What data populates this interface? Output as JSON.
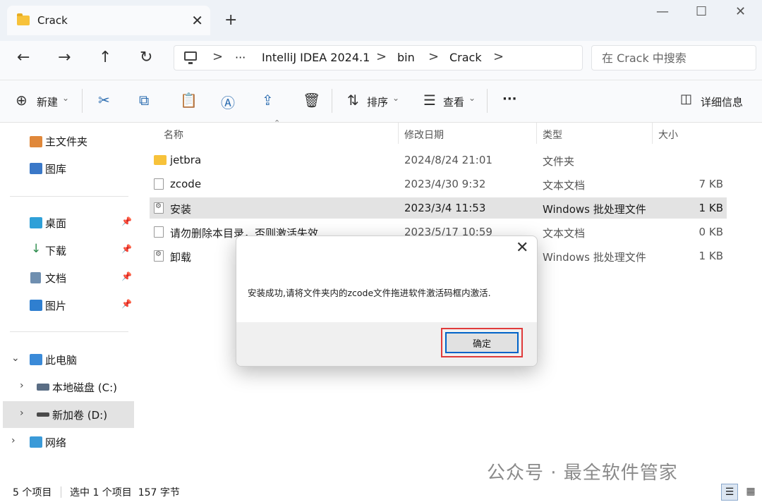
{
  "window": {
    "tab_title": "Crack",
    "close_tab": "✕",
    "new_tab": "+",
    "minimize": "—",
    "maximize": "☐",
    "close": "✕"
  },
  "nav": {
    "back": "←",
    "forward": "→",
    "up": "↑",
    "refresh": "↻"
  },
  "breadcrumb": {
    "more": "···",
    "items": [
      "IntelliJ IDEA 2024.1",
      "bin",
      "Crack"
    ],
    "separator": ">"
  },
  "search": {
    "placeholder": "在 Crack 中搜索"
  },
  "toolbar": {
    "new_label": "新建",
    "sort_label": "排序",
    "view_label": "查看",
    "more": "···",
    "details_label": "详细信息",
    "dropdown_caret": "⌄"
  },
  "sidebar": {
    "home": "主文件夹",
    "gallery": "图库",
    "quick": [
      {
        "label": "桌面",
        "icon": "desktop-icon"
      },
      {
        "label": "下载",
        "icon": "download-icon"
      },
      {
        "label": "文档",
        "icon": "document-icon"
      },
      {
        "label": "图片",
        "icon": "pictures-icon"
      }
    ],
    "pin": "📌",
    "this_pc": "此电脑",
    "drive_c": "本地磁盘 (C:)",
    "drive_d": "新加卷 (D:)",
    "network": "网络"
  },
  "columns": {
    "name": "名称",
    "modified": "修改日期",
    "type": "类型",
    "size": "大小"
  },
  "files": [
    {
      "name": "jetbra",
      "modified": "2024/8/24 21:01",
      "type": "文件夹",
      "size": "",
      "icon": "folder-icon"
    },
    {
      "name": "zcode",
      "modified": "2023/4/30 9:32",
      "type": "文本文档",
      "size": "7 KB",
      "icon": "text-file-icon"
    },
    {
      "name": "安装",
      "modified": "2023/3/4 11:53",
      "type": "Windows 批处理文件",
      "size": "1 KB",
      "icon": "batch-file-icon",
      "selected": true
    },
    {
      "name": "请勿删除本目录，否则激活失效",
      "modified": "2023/5/17 10:59",
      "type": "文本文档",
      "size": "0 KB",
      "icon": "text-file-icon"
    },
    {
      "name": "卸载",
      "modified": "",
      "type": "Windows 批处理文件",
      "size": "1 KB",
      "icon": "batch-file-icon"
    }
  ],
  "dialog": {
    "close": "✕",
    "message": "安装成功,请将文件夹内的zcode文件拖进软件激活码框内激活.",
    "ok_label": "确定"
  },
  "status": {
    "count": "5 个项目",
    "selection": "选中 1 个项目  157 字节"
  },
  "watermark": "公众号 · 最全软件管家",
  "colors": {
    "accent": "#0063c8",
    "highlight_box": "#e03a3a",
    "folder": "#f7c23a"
  }
}
